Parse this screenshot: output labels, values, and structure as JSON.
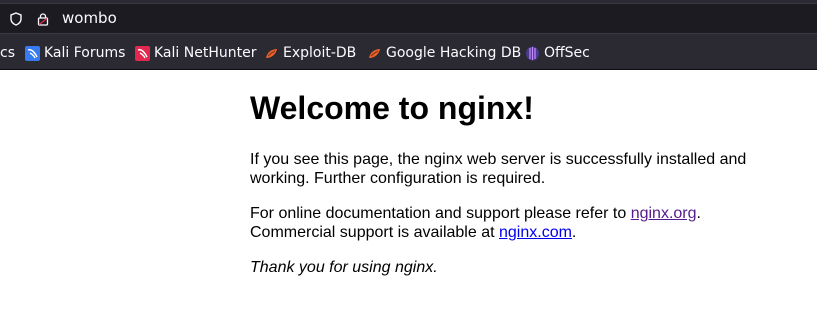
{
  "browser": {
    "url": "wombo",
    "bookmarks": [
      {
        "label": "cs",
        "icon": "none"
      },
      {
        "label": "Kali Forums",
        "icon": "kali-forums-icon"
      },
      {
        "label": "Kali NetHunter",
        "icon": "kali-nethunter-icon"
      },
      {
        "label": "Exploit-DB",
        "icon": "exploit-db-icon"
      },
      {
        "label": "Google Hacking DB",
        "icon": "google-hacking-db-icon"
      },
      {
        "label": "OffSec",
        "icon": "offsec-icon"
      }
    ]
  },
  "page": {
    "title": "Welcome to nginx!",
    "para1": "If you see this page, the nginx web server is successfully installed and working. Further configuration is required.",
    "para2_prefix": "For online documentation and support please refer to ",
    "link_org": "nginx.org",
    "para2_mid": ".",
    "para2_line2": "Commercial support is available at ",
    "link_com": "nginx.com",
    "para2_end": ".",
    "thanks": "Thank you for using nginx."
  },
  "colors": {
    "toolbar_bg": "#2b2a33",
    "urlbar_bg": "#1c1b22",
    "link": "#0000ee",
    "visited_link": "#551a8b"
  }
}
